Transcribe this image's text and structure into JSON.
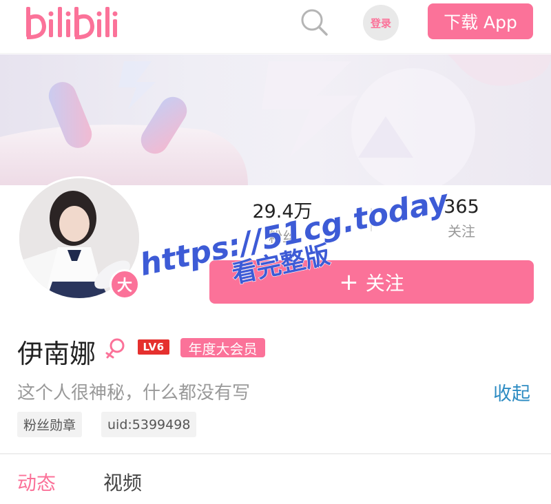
{
  "header": {
    "logo_text": "bilibili",
    "login_label": "登录",
    "download_label": "下载 App"
  },
  "profile": {
    "avatar_badge": "大",
    "fans_count": "29.4万",
    "fans_label": "粉丝",
    "following_count": "365",
    "following_label": "关注",
    "follow_button_label": "关注",
    "name": "伊南娜",
    "level": "LV6",
    "vip_label": "年度大会员",
    "bio": "这个人很神秘，什么都没有写",
    "collapse_label": "收起",
    "tags": [
      "粉丝勋章",
      "uid:5399498"
    ]
  },
  "tabs": [
    {
      "label": "动态",
      "active": true
    },
    {
      "label": "视频",
      "active": false
    }
  ],
  "watermark": {
    "line1": "https://51cg.today",
    "line2": "看完整版"
  },
  "colors": {
    "brand_pink": "#fb7299",
    "link_blue": "#2e8cc3",
    "level_red": "#e5302e",
    "watermark_blue": "#3d5bd6"
  },
  "icons": {
    "search": "search-icon",
    "gender": "female-icon"
  }
}
